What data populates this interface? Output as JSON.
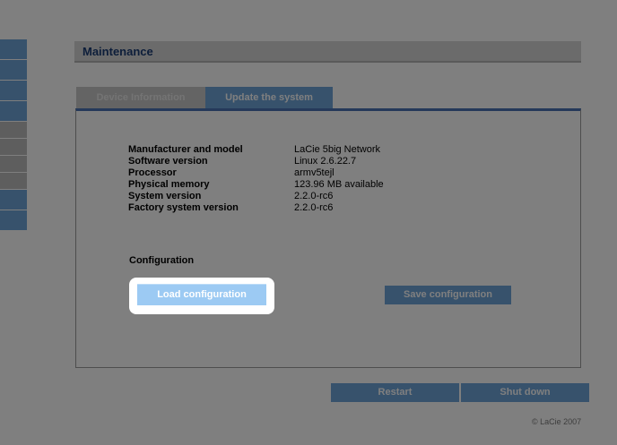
{
  "panel": {
    "title": "Maintenance"
  },
  "tabs": [
    {
      "label": "Device Information"
    },
    {
      "label": "Update the system"
    }
  ],
  "info": [
    {
      "key": "Manufacturer and model",
      "value": "LaCie 5big Network"
    },
    {
      "key": "Software version",
      "value": "Linux 2.6.22.7"
    },
    {
      "key": "Processor",
      "value": "armv5tejl"
    },
    {
      "key": "Physical memory",
      "value": "123.96 MB available"
    },
    {
      "key": "System version",
      "value": "2.2.0-rc6"
    },
    {
      "key": "Factory system version",
      "value": "2.2.0-rc6"
    }
  ],
  "configuration": {
    "label": "Configuration",
    "load_label": "Load configuration",
    "save_label": "Save configuration"
  },
  "footer": {
    "restart_label": "Restart",
    "shutdown_label": "Shut down",
    "copyright": "© LaCie 2007"
  },
  "colors": {
    "accent": "#6fa4d9",
    "title_text": "#1b3c75",
    "tab_border": "#4a73b4"
  }
}
